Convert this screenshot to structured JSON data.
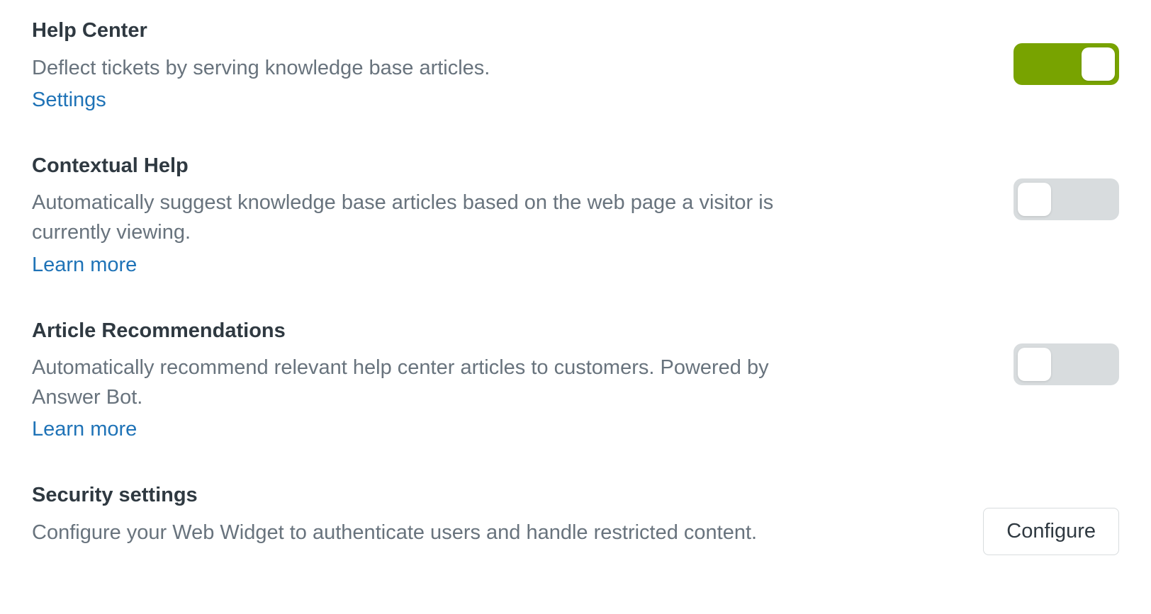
{
  "settings": [
    {
      "title": "Help Center",
      "description": "Deflect tickets by serving knowledge base articles.",
      "link_label": "Settings",
      "control_type": "toggle",
      "toggle_state": "on"
    },
    {
      "title": "Contextual Help",
      "description": "Automatically suggest knowledge base articles based on the web page a visitor is currently viewing.",
      "link_label": "Learn more",
      "control_type": "toggle",
      "toggle_state": "off"
    },
    {
      "title": "Article Recommendations",
      "description": "Automatically recommend relevant help center articles to customers. Powered by Answer Bot.",
      "link_label": "Learn more",
      "control_type": "toggle",
      "toggle_state": "off"
    },
    {
      "title": "Security settings",
      "description": "Configure your Web Widget to authenticate users and handle restricted content.",
      "link_label": "",
      "control_type": "button",
      "button_label": "Configure"
    }
  ]
}
